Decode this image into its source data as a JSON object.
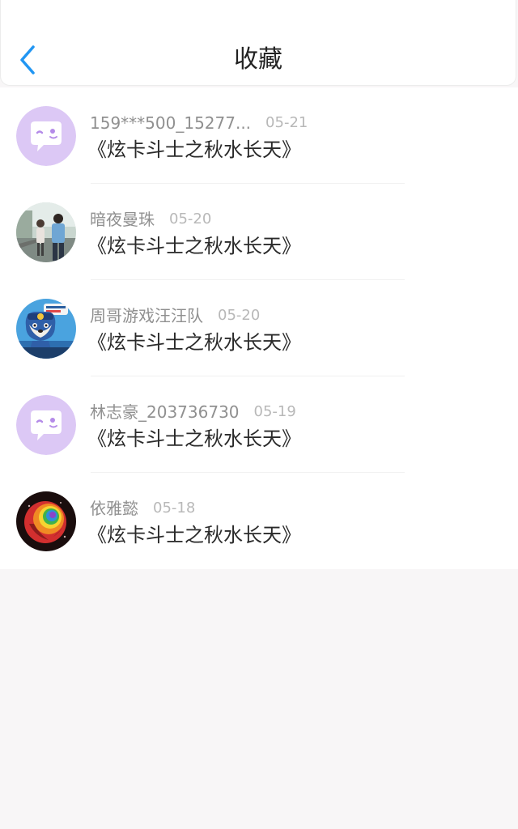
{
  "header": {
    "title": "收藏",
    "back_icon": "chevron-left-icon",
    "accent_color": "#2196f3"
  },
  "favorites": [
    {
      "username": "159***500_15277...",
      "date": "05-21",
      "book_title": "《炫卡斗士之秋水长天》",
      "avatar": "default-chat-avatar-icon"
    },
    {
      "username": "暗夜曼珠",
      "date": "05-20",
      "book_title": "《炫卡斗士之秋水长天》",
      "avatar": "couple-photo-avatar"
    },
    {
      "username": "周哥游戏汪汪队",
      "date": "05-20",
      "book_title": "《炫卡斗士之秋水长天》",
      "avatar": "cartoon-dog-avatar"
    },
    {
      "username": "林志豪_203736730",
      "date": "05-19",
      "book_title": "《炫卡斗士之秋水长天》",
      "avatar": "default-chat-avatar-icon"
    },
    {
      "username": "依雅懿",
      "date": "05-18",
      "book_title": "《炫卡斗士之秋水长天》",
      "avatar": "rainbow-rose-avatar"
    }
  ]
}
